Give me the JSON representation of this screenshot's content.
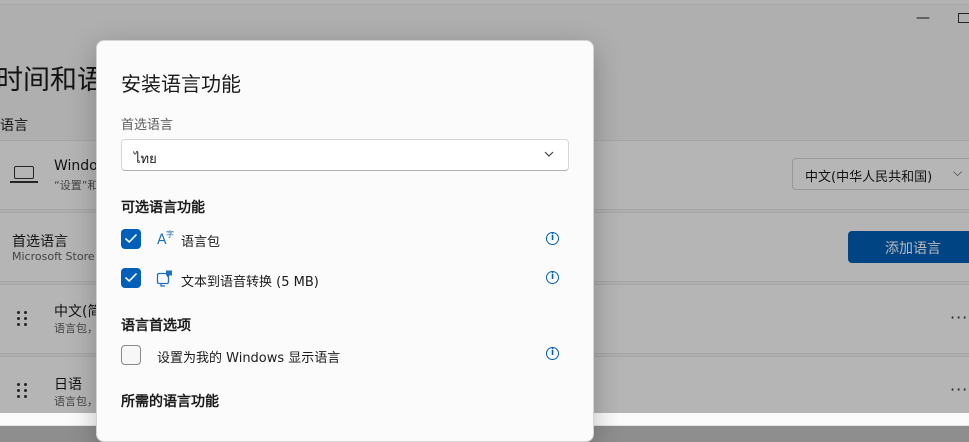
{
  "background": {
    "title": "时间和语",
    "section_label": "语言",
    "windows_display_row": {
      "title": "Windo",
      "subtitle": "“设置”和",
      "select_value": "中文(中华人民共和国)"
    },
    "preferred_row": {
      "title": "首选语言",
      "subtitle": "Microsoft Store",
      "add_button": "添加语言"
    },
    "languages": [
      {
        "name": "中文(简",
        "detail": "语言包，"
      },
      {
        "name": "日语",
        "detail": "语言包，"
      }
    ],
    "more_glyph": "···"
  },
  "dialog": {
    "title": "安装语言功能",
    "preferred_label": "首选语言",
    "selected_language": "ไทย",
    "optional_features_heading": "可选语言功能",
    "optional_features": [
      {
        "label": "语言包",
        "checked": true,
        "icon": "language-pack-icon"
      },
      {
        "label": "文本到语音转换 (5 MB)",
        "checked": true,
        "icon": "text-to-speech-icon"
      }
    ],
    "preferences_heading": "语言首选项",
    "preferences": [
      {
        "label": "设置为我的 Windows 显示语言",
        "checked": false
      }
    ],
    "required_features_heading": "所需的语言功能",
    "info_glyph": "i"
  },
  "colors": {
    "accent": "#005fb8"
  }
}
